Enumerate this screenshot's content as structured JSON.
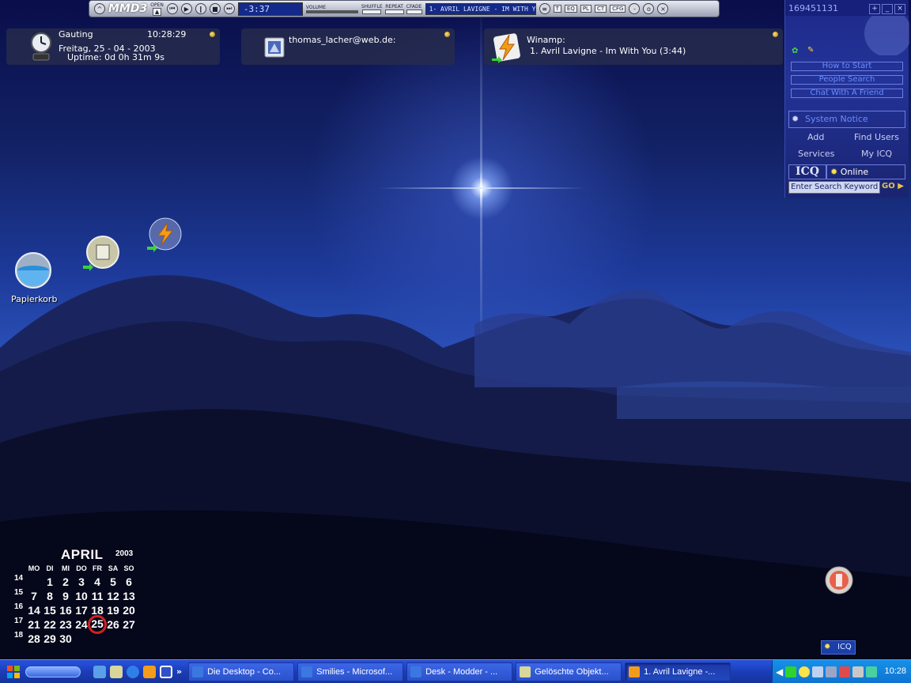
{
  "winamp": {
    "logo": "MMD3",
    "open_label": "OPEN",
    "time": "-3:37",
    "volume_label": "VOLUME",
    "shuffle_label": "SHUFFLE",
    "repeat_label": "REPEAT",
    "cfade_label": "CFADE",
    "track_title": "1- AVRIL LAVIGNE - IM WITH YOU",
    "buttons": [
      "T",
      "EQ",
      "PL",
      "CT",
      "CFG"
    ]
  },
  "widgets": {
    "clock": {
      "location": "Gauting",
      "time": "10:28:29",
      "date": "Freitag, 25 - 04 - 2003",
      "uptime": "Uptime: 0d 0h 31m 9s"
    },
    "mail": {
      "account": "thomas_lacher@web.de:"
    },
    "winamp": {
      "title": "Winamp:",
      "track": "1. Avril Lavigne - Im With You (3:44)"
    }
  },
  "icq": {
    "uin": "169451131",
    "links": [
      "How to Start",
      "People Search",
      "Chat With A Friend"
    ],
    "system_notice": "System Notice",
    "menu": {
      "add": "Add",
      "find_users": "Find Users",
      "services": "Services",
      "my_icq": "My ICQ"
    },
    "logo": "ICQ",
    "status": "Online",
    "search_placeholder": "Enter Search Keyword",
    "go": "GO"
  },
  "desktop": {
    "recycle_bin_label": "Papierkorb"
  },
  "calendar": {
    "month": "APRIL",
    "year": "2003",
    "weekdays": [
      "MO",
      "DI",
      "MI",
      "DO",
      "FR",
      "SA",
      "SO"
    ],
    "weeks": [
      {
        "num": "14",
        "days": [
          "",
          "1",
          "2",
          "3",
          "4",
          "5",
          "6"
        ]
      },
      {
        "num": "15",
        "days": [
          "7",
          "8",
          "9",
          "10",
          "11",
          "12",
          "13"
        ]
      },
      {
        "num": "16",
        "days": [
          "14",
          "15",
          "16",
          "17",
          "18",
          "19",
          "20"
        ]
      },
      {
        "num": "17",
        "days": [
          "21",
          "22",
          "23",
          "24",
          "25",
          "26",
          "27"
        ]
      },
      {
        "num": "18",
        "days": [
          "28",
          "29",
          "30",
          "",
          "",
          "",
          ""
        ]
      }
    ],
    "today": "25"
  },
  "taskbar": {
    "tasks": [
      {
        "label": "Die Desktop - Co...",
        "active": false
      },
      {
        "label": "Smilies - Microsof...",
        "active": false
      },
      {
        "label": "Desk - Modder - ...",
        "active": false
      },
      {
        "label": "Gelöschte Objekt...",
        "active": false
      },
      {
        "label": "1. Avril Lavigne -...",
        "active": true
      }
    ],
    "clock": "10:28",
    "icq_mini": "ICQ"
  }
}
